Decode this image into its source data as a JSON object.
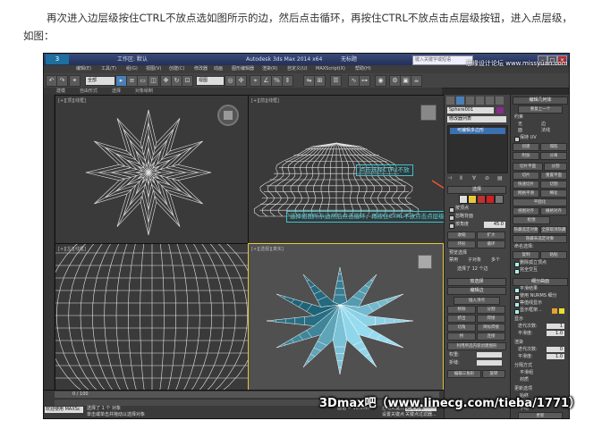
{
  "caption": {
    "line1": "再次进入边层级按住CTRL不放点选如图所示的边，然后点击循环，再按住CTRL不放点击点层级按钮，进入点层级，",
    "line2": "如图："
  },
  "titlebar": {
    "logo": "3",
    "workspace": "工作区: 默认",
    "app_title": "Autodesk 3ds Max  2014 x64",
    "doc_title": "无标题",
    "search_placeholder": "键入关键字或短语"
  },
  "menu": [
    "编辑(E)",
    "工具(T)",
    "组(G)",
    "视图(V)",
    "创建(C)",
    "修改器",
    "动画",
    "图形编辑器",
    "渲染(R)",
    "自定义(U)",
    "MAXScript(X)",
    "帮助(H)"
  ],
  "toolbar": {
    "filter_select": "全部",
    "view_select": "视图"
  },
  "ribbon_tabs": [
    "建模",
    "自由形式",
    "选择",
    "对象绘制"
  ],
  "viewports": {
    "top": "[+][顶][线框]",
    "front": "[+][前][线框]",
    "left": "[+][左][线框]",
    "perspective": "[+][透视][真实]"
  },
  "annotations": {
    "a1": "点击选择CTRL不放",
    "a2": "选择如图所示边然后点击循环，再按住CTRL不放点击点层级按钮"
  },
  "command_panel": {
    "object_name": "Sphere001",
    "modifier_list": "修改器列表",
    "stack_item": "可编辑多边形",
    "selection_title": "选择",
    "by_vertex": "按顶点",
    "ignore_backfacing": "忽略背面",
    "by_angle": "按角度",
    "angle_value": "45.0",
    "shrink": "收缩",
    "grow": "扩大",
    "ring": "环形",
    "loop": "循环",
    "preview_title": "预览选择",
    "preview_off": "禁用",
    "preview_sub": "子对象",
    "preview_multi": "多个",
    "selected_count": "选择了 12 个边",
    "soft_selection": "软选择",
    "edit_edges": "编辑边",
    "insert_vertex": "插入顶点",
    "remove": "移除",
    "split": "分割",
    "extrude": "挤出",
    "weld": "焊接",
    "chamfer": "切角",
    "target_weld": "目标焊接",
    "bridge": "桥",
    "connect": "连接",
    "create_shape": "利用所选内容创建图形",
    "weight": "权重:",
    "crease": "折缝:",
    "edit_tri": "编辑三角形",
    "rotate": "旋转"
  },
  "right_panel": {
    "edit_geometry": "编辑几何体",
    "repeat_last": "重复上一个",
    "constraints": "约束",
    "none": "无",
    "edge": "边",
    "face": "面",
    "normal": "法线",
    "preserve_uv": "保持 UV",
    "create": "创建",
    "collapse": "塌陷",
    "attach": "附加",
    "detach": "分离",
    "slice_plane": "切片平面",
    "split_btn": "分割",
    "slice": "切片",
    "reset_plane": "重置平面",
    "quickslice": "快速切片",
    "cut": "切割",
    "meshsmooth": "网格平滑",
    "tessellate": "细化",
    "make_planar": "平面化",
    "view_align": "视图对齐",
    "grid_align": "栅格对齐",
    "relax": "松弛",
    "hide_selected": "隐藏选定对象",
    "unhide_all": "全部取消隐藏",
    "hide_unselected": "隐藏未选定对象",
    "named_sel": "命名选择:",
    "copy": "复制",
    "paste": "粘贴",
    "delete_iso": "删除孤立顶点",
    "full_interactivity": "完全交互",
    "subdiv_surface": "细分曲面",
    "smooth_result": "平滑结果",
    "use_nurms": "使用 NURMS 细分",
    "isoline_display": "等值线显示",
    "show_cage": "显示框架...",
    "display": "显示",
    "iterations": "迭代次数:",
    "iterations_value": "1",
    "smoothness": "平滑度:",
    "smoothness_value": "1.0",
    "render": "渲染",
    "iter2": "迭代次数:",
    "iter2_value": "0",
    "smooth2": "平滑度:",
    "smooth2_value": "1.0",
    "sep_by": "分隔方式",
    "smoothing_groups": "平滑组",
    "materials": "材质",
    "update_options": "更新选项",
    "always": "始终",
    "when_rendering": "渲染时",
    "manually": "手动",
    "update": "更新"
  },
  "statusbar": {
    "selected": "选择了 1 个 对象",
    "hint": "单击或单击并拖动以选择对象",
    "frame": "0 / 100",
    "welcome": "欢迎使用 MAXSc",
    "grid": "栅格 = 10.0mm",
    "autokey": "自动关键点",
    "selected_obj": "选定对象",
    "set_key": "设置关键点",
    "key_filter": "关键点过滤器..."
  },
  "watermarks": {
    "bottom": "3Dmax吧（www.linecg.com/tieba/1771）",
    "top": "思缘设计论坛 www.missyuan.com"
  }
}
